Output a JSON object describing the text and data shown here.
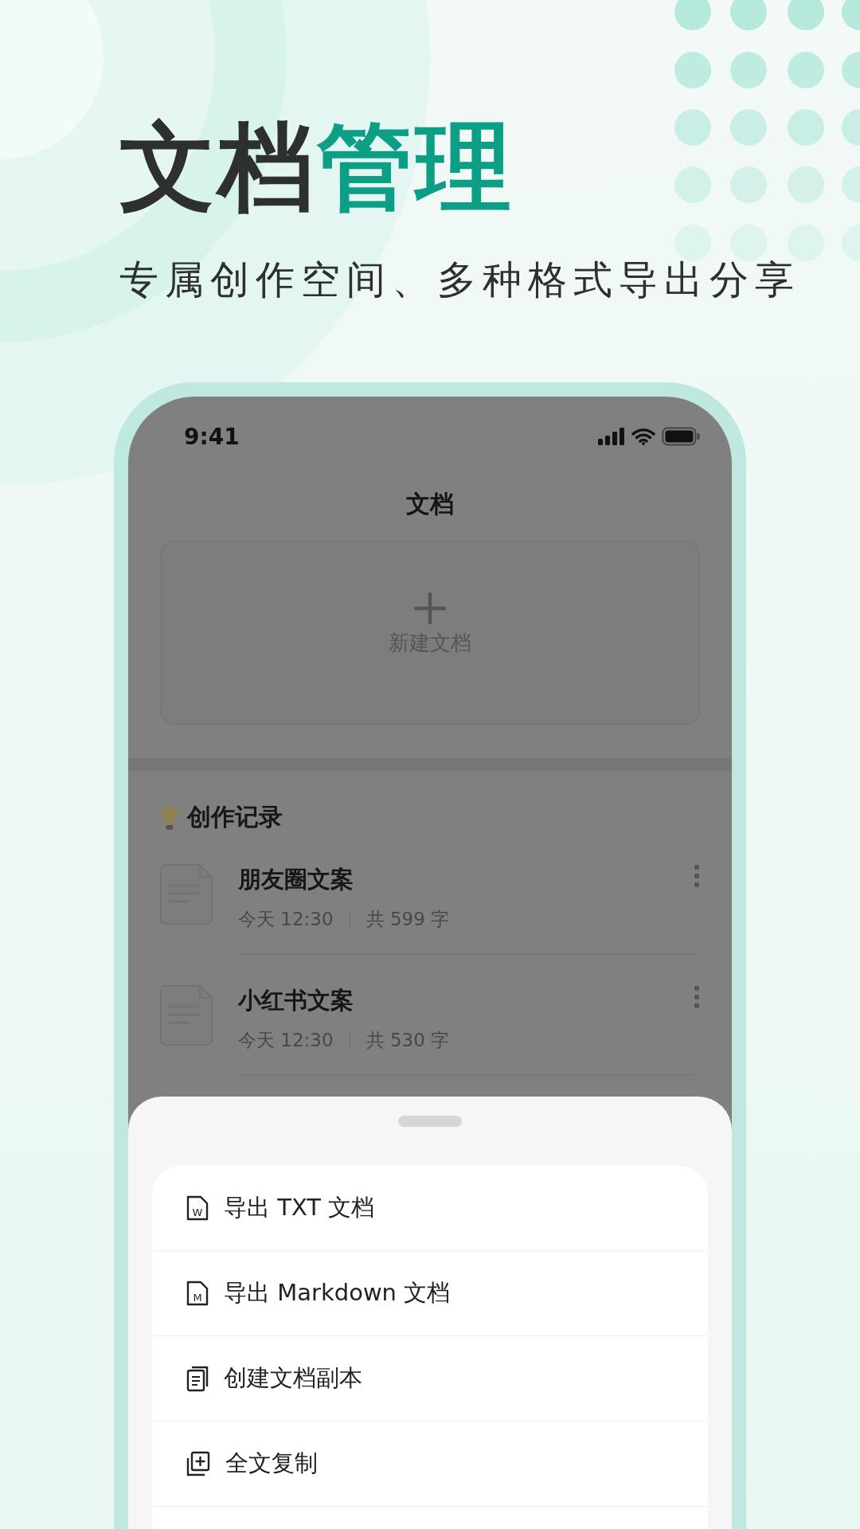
{
  "headline": {
    "dark": "文档",
    "accent": "管理"
  },
  "subtitle": "专属创作空间、多种格式导出分享",
  "status_bar": {
    "time": "9:41"
  },
  "screen": {
    "title": "文档",
    "new_doc_card": {
      "label": "新建文档"
    },
    "section_title": "创作记录",
    "documents": [
      {
        "title": "朋友圈文案",
        "date": "今天 12:30",
        "count": "共 599 字"
      },
      {
        "title": "小红书文案",
        "date": "今天 12:30",
        "count": "共 530 字"
      }
    ]
  },
  "action_sheet": {
    "items": [
      {
        "kind": "file",
        "badge": "W",
        "label": "导出 TXT 文档"
      },
      {
        "kind": "file",
        "badge": "M",
        "label": "导出 Markdown 文档"
      },
      {
        "kind": "duplicate",
        "label": "创建文档副本"
      },
      {
        "kind": "copy",
        "label": "全文复制"
      }
    ]
  }
}
